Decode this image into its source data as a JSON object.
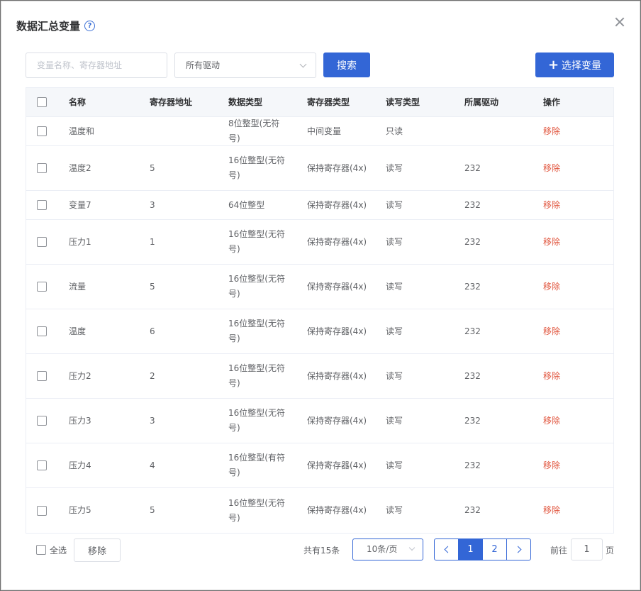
{
  "dialog": {
    "title": "数据汇总变量",
    "help_icon": "?"
  },
  "toolbar": {
    "search_placeholder": "变量名称、寄存器地址",
    "driver_select_value": "所有驱动",
    "search_label": "搜索",
    "select_var_plus": "+",
    "select_var_label": "选择变量"
  },
  "table": {
    "headers": [
      "名称",
      "寄存器地址",
      "数据类型",
      "寄存器类型",
      "读写类型",
      "所属驱动",
      "操作"
    ],
    "rows": [
      {
        "name": "温度和",
        "addr": "",
        "dtype": "8位整型(无符号)",
        "rtype": "中间变量",
        "rw": "只读",
        "driver": "",
        "op": "移除"
      },
      {
        "name": "温度2",
        "addr": "5",
        "dtype": "16位整型(无符号)",
        "rtype": "保持寄存器(4x)",
        "rw": "读写",
        "driver": "232",
        "op": "移除"
      },
      {
        "name": "变量7",
        "addr": "3",
        "dtype": "64位整型",
        "rtype": "保持寄存器(4x)",
        "rw": "读写",
        "driver": "232",
        "op": "移除"
      },
      {
        "name": "压力1",
        "addr": "1",
        "dtype": "16位整型(无符号)",
        "rtype": "保持寄存器(4x)",
        "rw": "读写",
        "driver": "232",
        "op": "移除"
      },
      {
        "name": "流量",
        "addr": "5",
        "dtype": "16位整型(无符号)",
        "rtype": "保持寄存器(4x)",
        "rw": "读写",
        "driver": "232",
        "op": "移除"
      },
      {
        "name": "温度",
        "addr": "6",
        "dtype": "16位整型(无符号)",
        "rtype": "保持寄存器(4x)",
        "rw": "读写",
        "driver": "232",
        "op": "移除"
      },
      {
        "name": "压力2",
        "addr": "2",
        "dtype": "16位整型(无符号)",
        "rtype": "保持寄存器(4x)",
        "rw": "读写",
        "driver": "232",
        "op": "移除"
      },
      {
        "name": "压力3",
        "addr": "3",
        "dtype": "16位整型(无符号)",
        "rtype": "保持寄存器(4x)",
        "rw": "读写",
        "driver": "232",
        "op": "移除"
      },
      {
        "name": "压力4",
        "addr": "4",
        "dtype": "16位整型(有符号)",
        "rtype": "保持寄存器(4x)",
        "rw": "读写",
        "driver": "232",
        "op": "移除"
      },
      {
        "name": "压力5",
        "addr": "5",
        "dtype": "16位整型(无符号)",
        "rtype": "保持寄存器(4x)",
        "rw": "读写",
        "driver": "232",
        "op": "移除"
      }
    ]
  },
  "footer": {
    "select_all_label": "全选",
    "remove_label": "移除",
    "total_text": "共有15条",
    "page_size_value": "10条/页",
    "pages": [
      "1",
      "2"
    ],
    "current_page": "1",
    "goto_label": "前往",
    "goto_value": "1",
    "page_unit": "页"
  },
  "colors": {
    "primary": "#3366d6",
    "danger": "#e0533b"
  }
}
